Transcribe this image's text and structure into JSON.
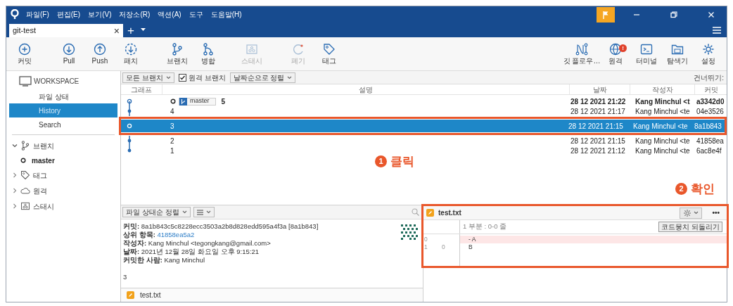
{
  "window": {
    "menu": [
      "파일(F)",
      "편집(E)",
      "보기(V)",
      "저장소(R)",
      "액션(A)",
      "도구",
      "도움말(H)"
    ],
    "tab": "git-test",
    "tab_close": "×",
    "new_tab": "+"
  },
  "toolbar": {
    "left": [
      {
        "kind": "commit",
        "label": "커밋",
        "disabled": false
      },
      {
        "kind": "pull",
        "label": "Pull",
        "disabled": false
      },
      {
        "kind": "push",
        "label": "Push",
        "disabled": false
      },
      {
        "kind": "fetch",
        "label": "패치",
        "disabled": false
      },
      {
        "kind": "branch",
        "label": "브랜치",
        "disabled": false
      },
      {
        "kind": "merge",
        "label": "병합",
        "disabled": false
      },
      {
        "kind": "stash",
        "label": "스태시",
        "disabled": true
      },
      {
        "kind": "discard",
        "label": "폐기",
        "disabled": true
      },
      {
        "kind": "tag",
        "label": "태그",
        "disabled": false
      }
    ],
    "right": [
      {
        "kind": "gitflow",
        "label": "깃 플로우…",
        "disabled": false
      },
      {
        "kind": "remote",
        "label": "원격",
        "badge": "!",
        "disabled": false
      },
      {
        "kind": "terminal",
        "label": "터미널",
        "disabled": false
      },
      {
        "kind": "explorer",
        "label": "탐색기",
        "disabled": false
      },
      {
        "kind": "settings",
        "label": "설정",
        "disabled": false
      }
    ]
  },
  "sidebar": {
    "workspace": "WORKSPACE",
    "items": [
      {
        "label": "파일 상태",
        "selected": false
      },
      {
        "label": "History",
        "selected": true
      },
      {
        "label": "Search",
        "selected": false
      }
    ],
    "sections": [
      {
        "kind": "branch",
        "label": "브랜치",
        "expanded": true,
        "children": [
          {
            "label": "master"
          }
        ]
      },
      {
        "kind": "tag",
        "label": "태그",
        "expanded": false
      },
      {
        "kind": "remote",
        "label": "원격",
        "expanded": false
      },
      {
        "kind": "stash",
        "label": "스태시",
        "expanded": false
      }
    ]
  },
  "filters": {
    "branches": "모든 브랜치",
    "remote_branches": {
      "label": "원격 브랜치",
      "checked": true
    },
    "sort": "날짜순으로 정렬",
    "skip": "건너뛰기:"
  },
  "history": {
    "columns": [
      "그래프",
      "설명",
      "날짜",
      "작성자",
      "커밋"
    ],
    "rows": [
      {
        "description": "5",
        "branch": "master",
        "date": "28 12 2021 21:22",
        "author": "Kang Minchul <t",
        "commit": "a3342d0",
        "bold": true,
        "selected": false
      },
      {
        "description": "4",
        "date": "28 12 2021 21:17",
        "author": "Kang Minchul <te",
        "commit": "04e3526",
        "bold": false,
        "selected": false
      },
      {
        "description": "3",
        "date": "28 12 2021 21:15",
        "author": "Kang Minchul <te",
        "commit": "8a1b843",
        "bold": false,
        "selected": true
      },
      {
        "description": "2",
        "date": "28 12 2021 21:15",
        "author": "Kang Minchul <te",
        "commit": "41858ea",
        "bold": false,
        "selected": false
      },
      {
        "description": "1",
        "date": "28 12 2021 21:12",
        "author": "Kang Minchul <te",
        "commit": "6ac8e4f",
        "bold": false,
        "selected": false
      }
    ]
  },
  "details": {
    "sort": "파일 상태순 정렬",
    "lines": [
      {
        "text": "**커밋:** 8a1b843c5c8228ecc3503a2b8d828edd595a4f3a [8a1b843]"
      },
      {
        "text": "**상위 항목:**",
        "link": "41858ea5a2"
      },
      {
        "text": "**작성자:** Kang Minchul <tegongkang@gmail.com>"
      },
      {
        "text": "**날짜:** 2021년 12월 28일 화요일 오후 9:15:21"
      },
      {
        "text": "**커밋한 사람:** Kang Minchul"
      }
    ],
    "message": "3",
    "files": [
      {
        "name": "test.txt"
      }
    ]
  },
  "diff": {
    "file": "test.txt",
    "more": "•••",
    "hunk": "1 부분 : 0-0 줄",
    "revert": "코드뭉치 되돌리기",
    "lines": [
      {
        "kind": "removed",
        "old": "0",
        "text": "- A"
      },
      {
        "kind": "context",
        "old": "1",
        "new": "0",
        "text": "B"
      }
    ]
  },
  "annotations": [
    {
      "number": "1",
      "text": "클릭"
    },
    {
      "number": "2",
      "text": "확인"
    }
  ]
}
